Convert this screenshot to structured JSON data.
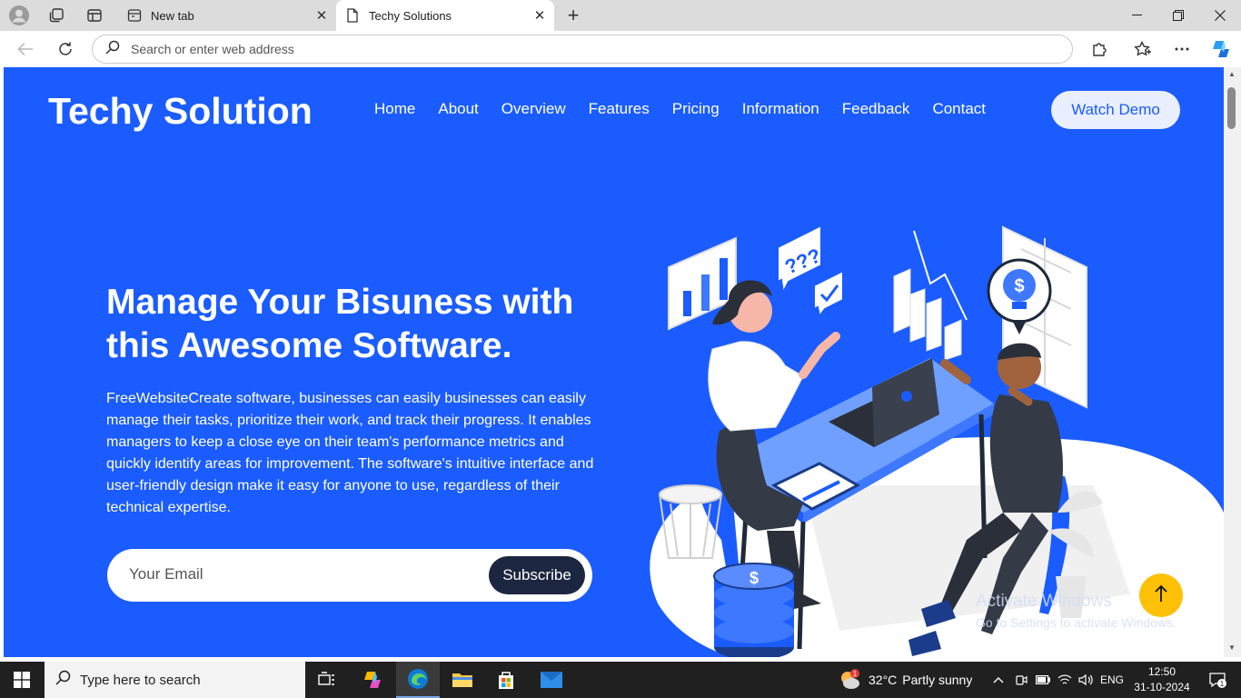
{
  "browser": {
    "tabs": [
      {
        "label": "New tab",
        "active": false
      },
      {
        "label": "Techy Solutions",
        "active": true
      }
    ],
    "address_placeholder": "Search or enter web address"
  },
  "site": {
    "brand": "Techy Solution",
    "nav": [
      "Home",
      "About",
      "Overview",
      "Features",
      "Pricing",
      "Information",
      "Feedback",
      "Contact"
    ],
    "demo_button": "Watch Demo",
    "headline_line1": "Manage Your Bisuness with",
    "headline_line2": "this Awesome Software.",
    "description": "FreeWebsiteCreate software, businesses can easily businesses can easily manage their tasks, prioritize their work, and track their progress. It enables managers to keep a close eye on their team's performance metrics and quickly identify areas for improvement. The software's intuitive interface and user-friendly design make it easy for anyone to use, regardless of their technical expertise.",
    "email_placeholder": "Your Email",
    "subscribe_button": "Subscribe",
    "illustration_bubble_text": "???"
  },
  "watermark": {
    "line1": "Activate Windows",
    "line2": "Go to Settings to activate Windows."
  },
  "taskbar": {
    "search_placeholder": "Type here to search",
    "weather_temp": "32°C",
    "weather_desc": "Partly sunny",
    "weather_badge": "1",
    "language": "ENG",
    "time": "12:50",
    "date": "31-10-2024",
    "notification_count": "1"
  },
  "colors": {
    "page_bg": "#1a5cff",
    "accent_yellow": "#ffc107",
    "subscribe_bg": "#1c2640",
    "taskbar_bg": "#202020"
  },
  "icons": [
    "profile-icon",
    "workspaces-icon",
    "tab-actions-icon",
    "page-icon",
    "close-icon",
    "new-tab-icon",
    "minimize-icon",
    "restore-icon",
    "back-icon",
    "refresh-icon",
    "search-icon",
    "extensions-icon",
    "favorites-icon",
    "more-icon",
    "copilot-icon",
    "arrow-up-icon",
    "windows-start-icon",
    "task-view-icon",
    "edge-icon",
    "file-explorer-icon",
    "store-icon",
    "mail-icon"
  ]
}
